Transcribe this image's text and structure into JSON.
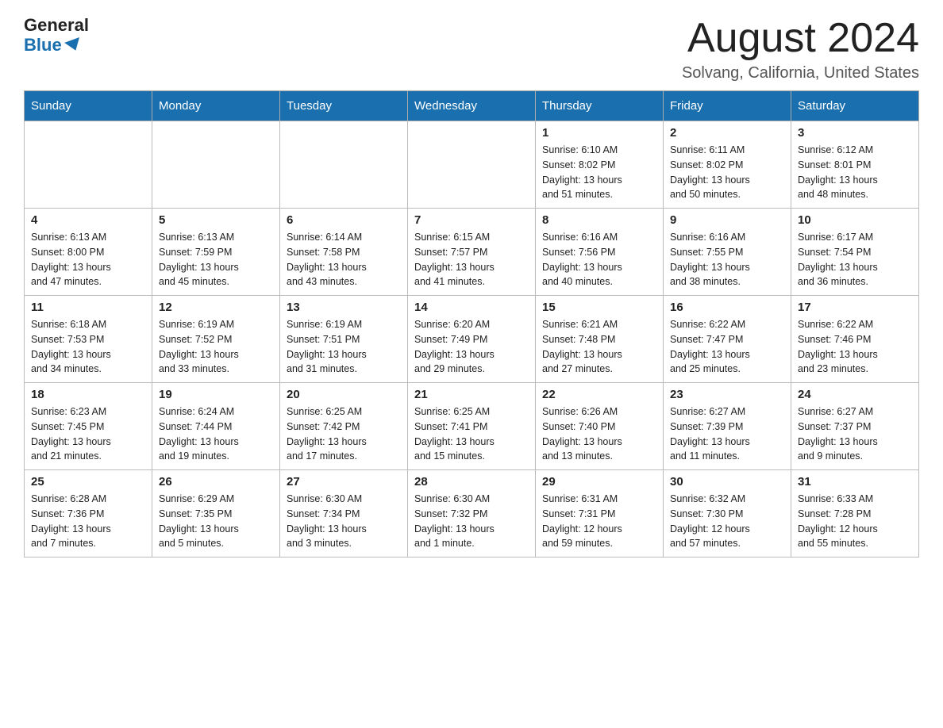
{
  "header": {
    "logo_general": "General",
    "logo_blue": "Blue",
    "month_title": "August 2024",
    "location": "Solvang, California, United States"
  },
  "days_of_week": [
    "Sunday",
    "Monday",
    "Tuesday",
    "Wednesday",
    "Thursday",
    "Friday",
    "Saturday"
  ],
  "weeks": [
    [
      {
        "day": "",
        "info": ""
      },
      {
        "day": "",
        "info": ""
      },
      {
        "day": "",
        "info": ""
      },
      {
        "day": "",
        "info": ""
      },
      {
        "day": "1",
        "info": "Sunrise: 6:10 AM\nSunset: 8:02 PM\nDaylight: 13 hours\nand 51 minutes."
      },
      {
        "day": "2",
        "info": "Sunrise: 6:11 AM\nSunset: 8:02 PM\nDaylight: 13 hours\nand 50 minutes."
      },
      {
        "day": "3",
        "info": "Sunrise: 6:12 AM\nSunset: 8:01 PM\nDaylight: 13 hours\nand 48 minutes."
      }
    ],
    [
      {
        "day": "4",
        "info": "Sunrise: 6:13 AM\nSunset: 8:00 PM\nDaylight: 13 hours\nand 47 minutes."
      },
      {
        "day": "5",
        "info": "Sunrise: 6:13 AM\nSunset: 7:59 PM\nDaylight: 13 hours\nand 45 minutes."
      },
      {
        "day": "6",
        "info": "Sunrise: 6:14 AM\nSunset: 7:58 PM\nDaylight: 13 hours\nand 43 minutes."
      },
      {
        "day": "7",
        "info": "Sunrise: 6:15 AM\nSunset: 7:57 PM\nDaylight: 13 hours\nand 41 minutes."
      },
      {
        "day": "8",
        "info": "Sunrise: 6:16 AM\nSunset: 7:56 PM\nDaylight: 13 hours\nand 40 minutes."
      },
      {
        "day": "9",
        "info": "Sunrise: 6:16 AM\nSunset: 7:55 PM\nDaylight: 13 hours\nand 38 minutes."
      },
      {
        "day": "10",
        "info": "Sunrise: 6:17 AM\nSunset: 7:54 PM\nDaylight: 13 hours\nand 36 minutes."
      }
    ],
    [
      {
        "day": "11",
        "info": "Sunrise: 6:18 AM\nSunset: 7:53 PM\nDaylight: 13 hours\nand 34 minutes."
      },
      {
        "day": "12",
        "info": "Sunrise: 6:19 AM\nSunset: 7:52 PM\nDaylight: 13 hours\nand 33 minutes."
      },
      {
        "day": "13",
        "info": "Sunrise: 6:19 AM\nSunset: 7:51 PM\nDaylight: 13 hours\nand 31 minutes."
      },
      {
        "day": "14",
        "info": "Sunrise: 6:20 AM\nSunset: 7:49 PM\nDaylight: 13 hours\nand 29 minutes."
      },
      {
        "day": "15",
        "info": "Sunrise: 6:21 AM\nSunset: 7:48 PM\nDaylight: 13 hours\nand 27 minutes."
      },
      {
        "day": "16",
        "info": "Sunrise: 6:22 AM\nSunset: 7:47 PM\nDaylight: 13 hours\nand 25 minutes."
      },
      {
        "day": "17",
        "info": "Sunrise: 6:22 AM\nSunset: 7:46 PM\nDaylight: 13 hours\nand 23 minutes."
      }
    ],
    [
      {
        "day": "18",
        "info": "Sunrise: 6:23 AM\nSunset: 7:45 PM\nDaylight: 13 hours\nand 21 minutes."
      },
      {
        "day": "19",
        "info": "Sunrise: 6:24 AM\nSunset: 7:44 PM\nDaylight: 13 hours\nand 19 minutes."
      },
      {
        "day": "20",
        "info": "Sunrise: 6:25 AM\nSunset: 7:42 PM\nDaylight: 13 hours\nand 17 minutes."
      },
      {
        "day": "21",
        "info": "Sunrise: 6:25 AM\nSunset: 7:41 PM\nDaylight: 13 hours\nand 15 minutes."
      },
      {
        "day": "22",
        "info": "Sunrise: 6:26 AM\nSunset: 7:40 PM\nDaylight: 13 hours\nand 13 minutes."
      },
      {
        "day": "23",
        "info": "Sunrise: 6:27 AM\nSunset: 7:39 PM\nDaylight: 13 hours\nand 11 minutes."
      },
      {
        "day": "24",
        "info": "Sunrise: 6:27 AM\nSunset: 7:37 PM\nDaylight: 13 hours\nand 9 minutes."
      }
    ],
    [
      {
        "day": "25",
        "info": "Sunrise: 6:28 AM\nSunset: 7:36 PM\nDaylight: 13 hours\nand 7 minutes."
      },
      {
        "day": "26",
        "info": "Sunrise: 6:29 AM\nSunset: 7:35 PM\nDaylight: 13 hours\nand 5 minutes."
      },
      {
        "day": "27",
        "info": "Sunrise: 6:30 AM\nSunset: 7:34 PM\nDaylight: 13 hours\nand 3 minutes."
      },
      {
        "day": "28",
        "info": "Sunrise: 6:30 AM\nSunset: 7:32 PM\nDaylight: 13 hours\nand 1 minute."
      },
      {
        "day": "29",
        "info": "Sunrise: 6:31 AM\nSunset: 7:31 PM\nDaylight: 12 hours\nand 59 minutes."
      },
      {
        "day": "30",
        "info": "Sunrise: 6:32 AM\nSunset: 7:30 PM\nDaylight: 12 hours\nand 57 minutes."
      },
      {
        "day": "31",
        "info": "Sunrise: 6:33 AM\nSunset: 7:28 PM\nDaylight: 12 hours\nand 55 minutes."
      }
    ]
  ]
}
